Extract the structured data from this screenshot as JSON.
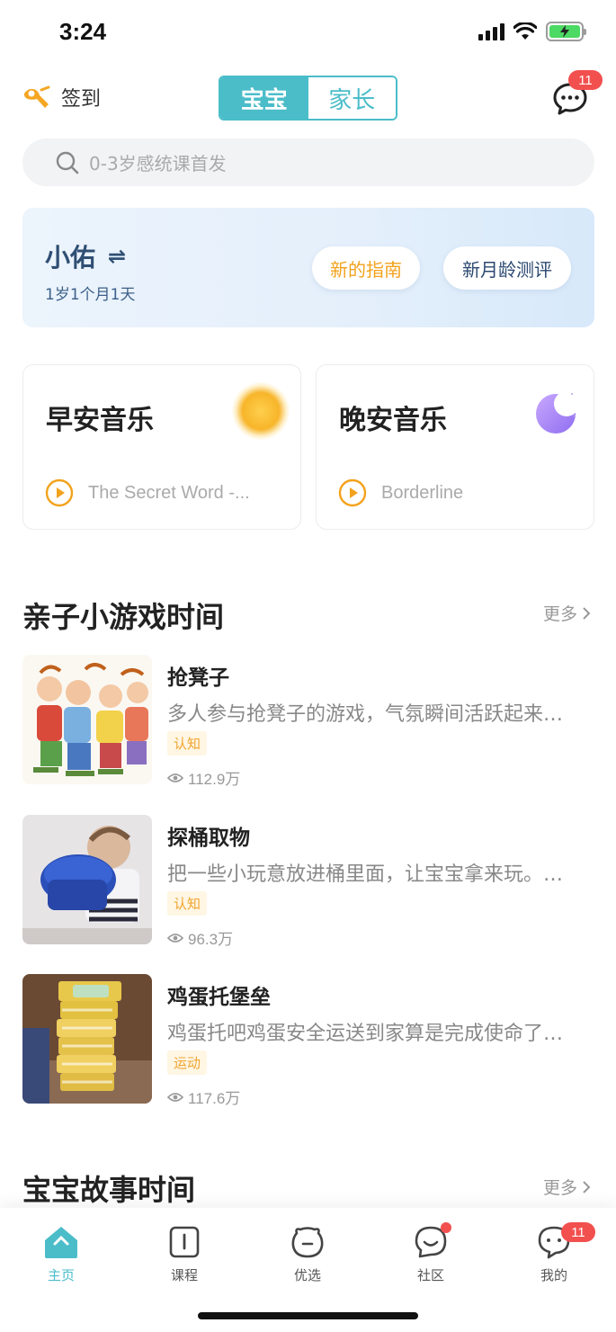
{
  "status_bar": {
    "time": "3:24"
  },
  "header": {
    "checkin_label": "签到",
    "switcher": {
      "tabs": [
        "宝宝",
        "家长"
      ],
      "active": "宝宝"
    },
    "message_badge": "11"
  },
  "search": {
    "placeholder": "0-3岁感统课首发"
  },
  "baby": {
    "name": "小佑",
    "switch_icon": "⇌",
    "age": "1岁1个月1天",
    "guide_button": "新的指南",
    "eval_button": "新月龄测评"
  },
  "music": {
    "morning": {
      "title": "早安音乐",
      "track": "The Secret Word -..."
    },
    "night": {
      "title": "晚安音乐",
      "track": "Borderline"
    }
  },
  "games_section": {
    "title": "亲子小游戏时间",
    "more": "更多",
    "items": [
      {
        "title": "抢凳子",
        "desc": "多人参与抢凳子的游戏，气氛瞬间活跃起来…",
        "tag": "认知",
        "views": "112.9万"
      },
      {
        "title": "探桶取物",
        "desc": "把一些小玩意放进桶里面，让宝宝拿来玩。…",
        "tag": "认知",
        "views": "96.3万"
      },
      {
        "title": "鸡蛋托堡垒",
        "desc": "鸡蛋托吧鸡蛋安全运送到家算是完成使命了…",
        "tag": "运动",
        "views": "117.6万"
      }
    ]
  },
  "stories_section": {
    "title": "宝宝故事时间",
    "more": "更多"
  },
  "tabbar": {
    "items": [
      "主页",
      "课程",
      "优选",
      "社区",
      "我的"
    ],
    "active": "主页",
    "mine_badge": "11"
  },
  "colors": {
    "accent": "#4bbdc9",
    "badge": "#f2504f",
    "tag": "#f0a531",
    "guide": "#f3a21c"
  }
}
